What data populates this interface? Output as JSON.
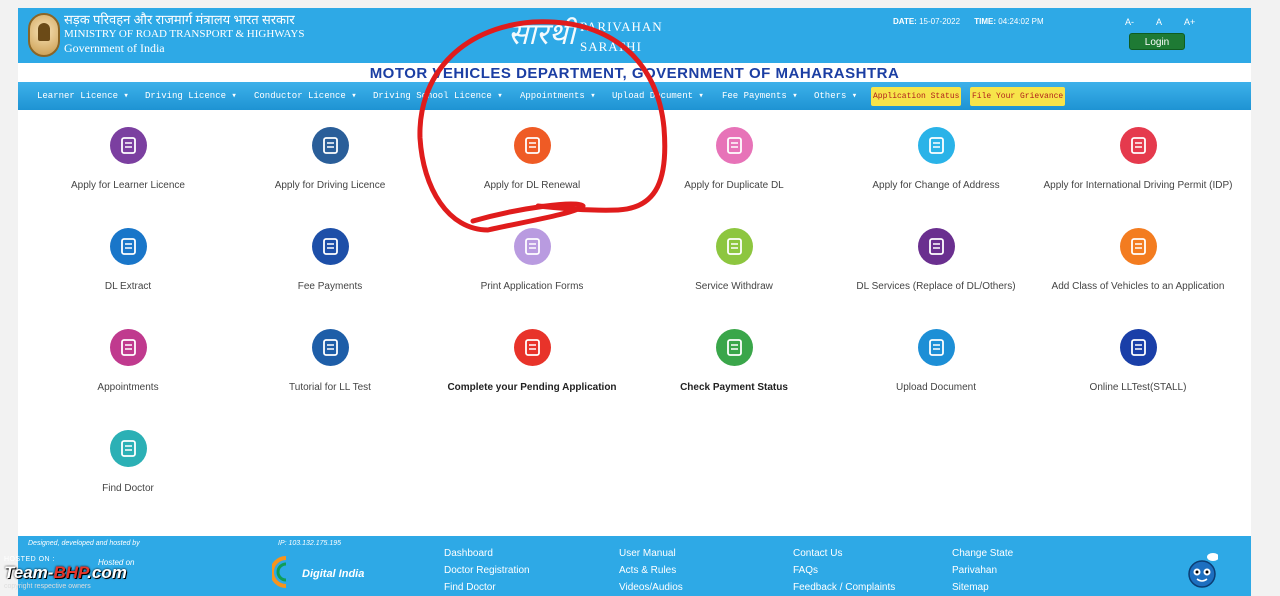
{
  "header": {
    "ministry_hi": "सड़क परिवहन और राजमार्ग मंत्रालय भारत सरकार",
    "ministry_en": "MINISTRY OF ROAD TRANSPORT & HIGHWAYS",
    "government": "Government of India",
    "logo_hindi": "सारथी",
    "logo_line1": "PARIVAHAN",
    "logo_line2": "SARATHI",
    "date_label": "DATE:",
    "date_value": "15-07-2022",
    "time_label": "TIME:",
    "time_value": "04:24:02 PM",
    "font_small": "A-",
    "font_normal": "A",
    "font_large": "A+",
    "login_label": "Login"
  },
  "department_title": "MOTOR VEHICLES DEPARTMENT, GOVERNMENT OF MAHARASHTRA",
  "nav": {
    "items": [
      "Learner Licence ▾",
      "Driving Licence ▾",
      "Conductor Licence ▾",
      "Driving School Licence ▾",
      "Appointments ▾",
      "Upload Document ▾",
      "Fee Payments ▾",
      "Others ▾"
    ],
    "highlight1": "Application Status",
    "highlight2": "File Your Grievance"
  },
  "services": [
    {
      "label": "Apply for Learner Licence",
      "color": "#7b3fa0",
      "icon": "learner-licence-icon"
    },
    {
      "label": "Apply for Driving Licence",
      "color": "#2a5e99",
      "icon": "driving-licence-icon"
    },
    {
      "label": "Apply for DL Renewal",
      "color": "#ef5b25",
      "icon": "dl-renewal-icon"
    },
    {
      "label": "Apply for Duplicate DL",
      "color": "#e773b8",
      "icon": "duplicate-dl-icon"
    },
    {
      "label": "Apply for Change of Address",
      "color": "#2ab3e8",
      "icon": "change-address-icon"
    },
    {
      "label": "Apply for International Driving Permit (IDP)",
      "color": "#e53a4d",
      "icon": "idp-icon"
    },
    {
      "label": "DL Extract",
      "color": "#1976c9",
      "icon": "dl-extract-icon"
    },
    {
      "label": "Fee Payments",
      "color": "#1d4fa8",
      "icon": "fee-payments-icon"
    },
    {
      "label": "Print Application Forms",
      "color": "#b99be0",
      "icon": "print-icon"
    },
    {
      "label": "Service Withdraw",
      "color": "#8dc63f",
      "icon": "service-withdraw-icon"
    },
    {
      "label": "DL Services (Replace of DL/Others)",
      "color": "#6a2f8f",
      "icon": "dl-services-icon"
    },
    {
      "label": "Add Class of Vehicles to an Application",
      "color": "#f37c20",
      "icon": "add-class-icon"
    },
    {
      "label": "Appointments",
      "color": "#c03a8e",
      "icon": "appointments-icon"
    },
    {
      "label": "Tutorial for LL Test",
      "color": "#1e5ea8",
      "icon": "tutorial-icon"
    },
    {
      "label": "Complete your Pending Application",
      "color": "#e8332a",
      "icon": "pending-application-icon"
    },
    {
      "label": "Check Payment Status",
      "color": "#3aa64a",
      "icon": "payment-status-icon"
    },
    {
      "label": "Upload Document",
      "color": "#1d8fd6",
      "icon": "upload-document-icon"
    },
    {
      "label": "Online LLTest(STALL)",
      "color": "#1a3fa8",
      "icon": "online-lltest-icon"
    },
    {
      "label": "Find Doctor",
      "color": "#2bb0b5",
      "icon": "find-doctor-icon"
    }
  ],
  "footer": {
    "designed_by": "Designed, developed and hosted by",
    "ip": "IP: 103.132.175.195",
    "hosted_on": "Hosted on",
    "digital_india": "Digital India",
    "links_col1": [
      "Dashboard",
      "Doctor Registration",
      "Find Doctor"
    ],
    "links_col2": [
      "User Manual",
      "Acts & Rules",
      "Videos/Audios"
    ],
    "links_col3": [
      "Contact Us",
      "FAQs",
      "Feedback / Complaints"
    ],
    "links_col4": [
      "Change State",
      "Parivahan",
      "Sitemap"
    ]
  },
  "watermark": {
    "hosted": "HOSTED ON :",
    "brand_team": "Team-",
    "brand_bhp": "BHP",
    "brand_com": ".com",
    "copyright": "copyright respective owners"
  }
}
